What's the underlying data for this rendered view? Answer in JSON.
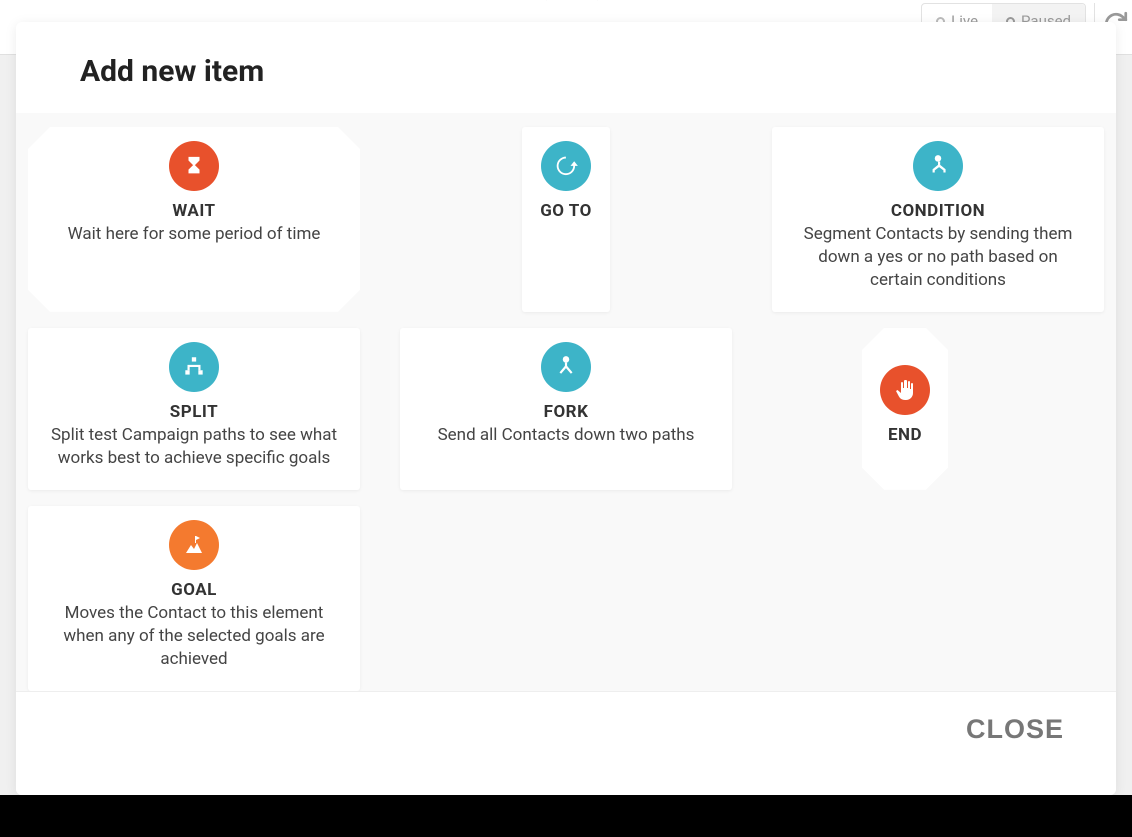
{
  "status_bar": {
    "live": "Live",
    "paused": "Paused"
  },
  "modal": {
    "title": "Add new item",
    "close_label": "CLOSE"
  },
  "items": {
    "wait": {
      "title": "WAIT",
      "desc": "Wait here for some period of time"
    },
    "goto": {
      "title": "GO TO",
      "desc": ""
    },
    "condition": {
      "title": "CONDITION",
      "desc": "Segment Contacts by sending them down a yes or no path based on certain conditions"
    },
    "split": {
      "title": "SPLIT",
      "desc": "Split test Campaign paths to see what works best to achieve specific goals"
    },
    "fork": {
      "title": "FORK",
      "desc": "Send all Contacts down two paths"
    },
    "end": {
      "title": "END",
      "desc": ""
    },
    "goal": {
      "title": "GOAL",
      "desc": "Moves the Contact to this element when any of the selected goals are achieved"
    }
  }
}
